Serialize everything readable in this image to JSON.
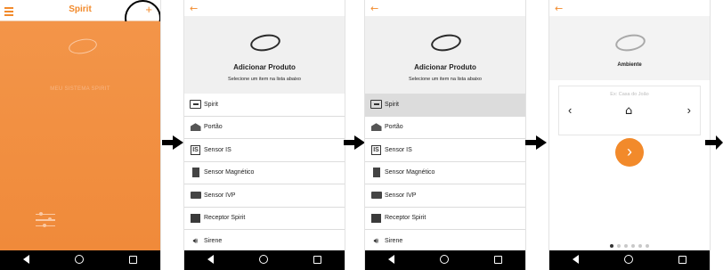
{
  "screen1": {
    "title": "Spirit",
    "menu_icon": "hamburger-menu-icon",
    "add_icon": "+",
    "subtitle": "MEU SISTEMA SPIRIT",
    "nav": {
      "back": "◁",
      "home": "○",
      "recent": "□"
    }
  },
  "product_list": {
    "back_icon": "←",
    "title": "Adicionar Produto",
    "subtitle": "Selecione um item na lista abaixo",
    "items": [
      {
        "label": "Spirit",
        "icon": "spirit-icon"
      },
      {
        "label": "Portão",
        "icon": "gate-icon"
      },
      {
        "label": "Sensor IS",
        "icon": "sensor-is-icon"
      },
      {
        "label": "Sensor Magnético",
        "icon": "magnetic-sensor-icon"
      },
      {
        "label": "Sensor IVP",
        "icon": "ivp-sensor-icon"
      },
      {
        "label": "Receptor Spirit",
        "icon": "receiver-icon"
      },
      {
        "label": "Sirene",
        "icon": "siren-icon"
      }
    ],
    "sensor_is_glyph": "IS",
    "siren_glyph": "🔊︎"
  },
  "screen3": {
    "selected_item": "Spirit"
  },
  "screen4": {
    "back_icon": "←",
    "title": "Ambiente",
    "placeholder": "Ex: Casa do João",
    "prev": "‹",
    "next": "›",
    "home_glyph": "⌂",
    "go": "›",
    "pages": 6,
    "current_page": 1
  },
  "colors": {
    "accent": "#f28a2b",
    "nav_bar": "#000000"
  }
}
